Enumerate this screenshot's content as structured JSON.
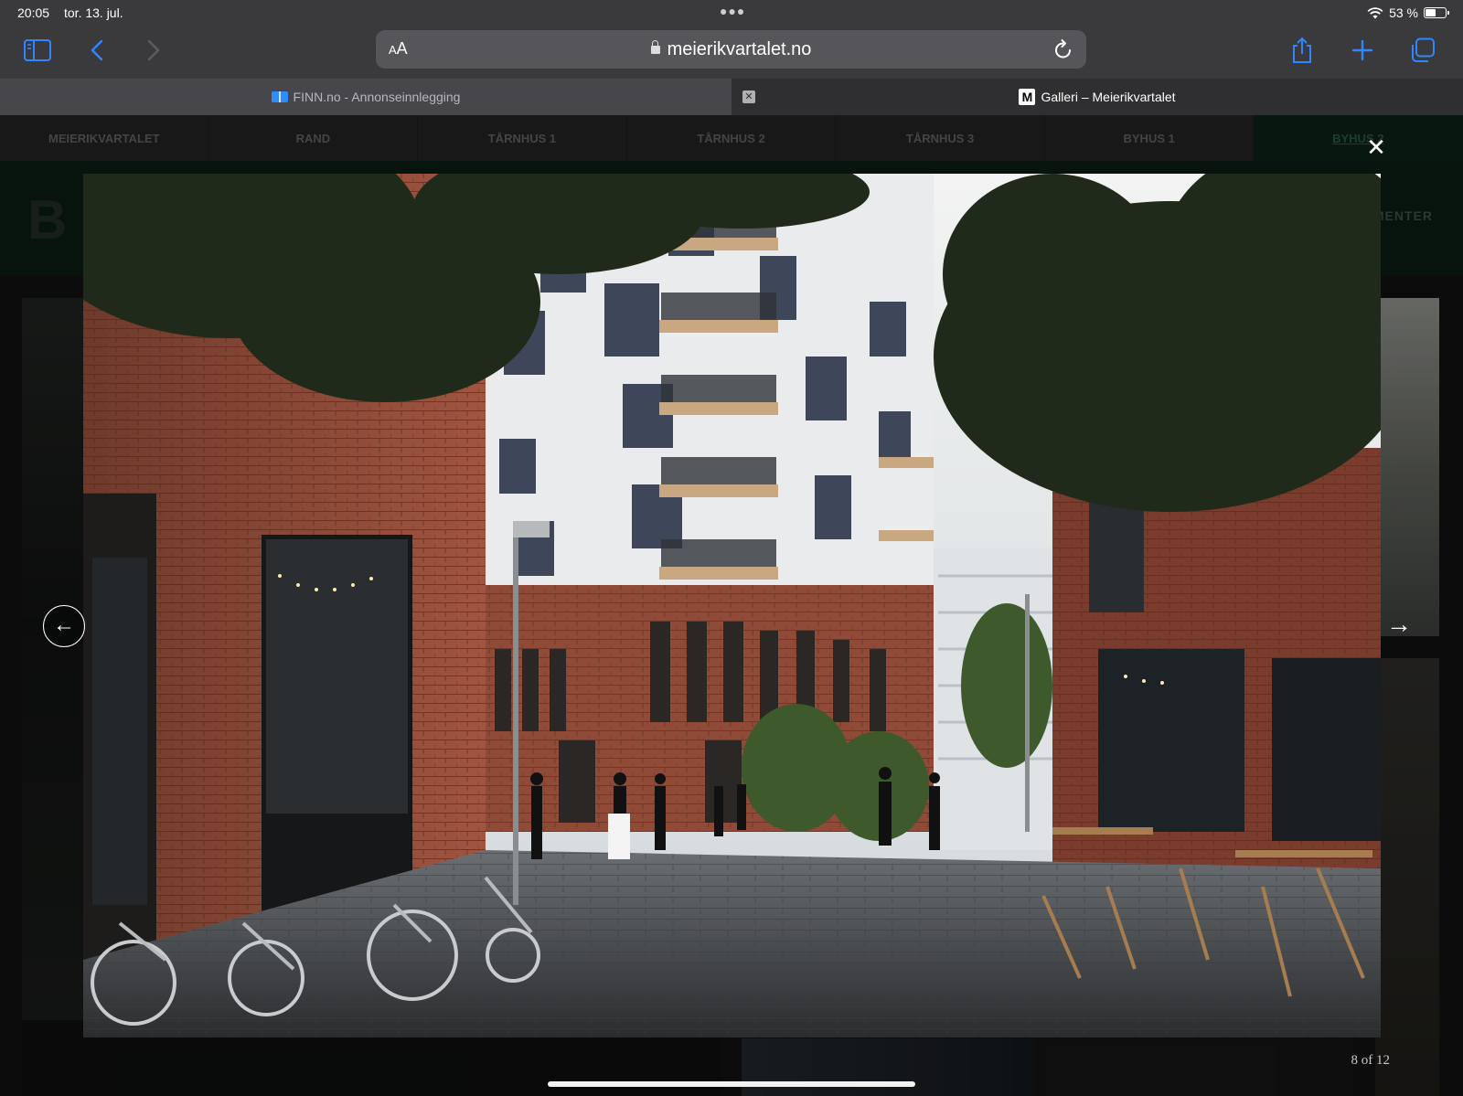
{
  "status_bar": {
    "time": "20:05",
    "date": "tor. 13. jul.",
    "battery": "53 %",
    "battery_level": 0.53
  },
  "toolbar": {
    "url_aa_small": "A",
    "url_aa_large": "A",
    "url": "meierikvartalet.no"
  },
  "tabs": [
    {
      "title": "FINN.no - Annonseinnlegging",
      "active": false,
      "icon": "finn-book-icon"
    },
    {
      "title": "Galleri – Meierikvartalet",
      "active": true,
      "icon": "m-logo-icon"
    }
  ],
  "site": {
    "nav": [
      "MEIERIKVARTALET",
      "RAND",
      "TÅRNHUS 1",
      "TÅRNHUS 2",
      "TÅRNHUS 3",
      "BYHUS 1",
      "BYHUS 2"
    ],
    "nav_active_index": 6,
    "logo_letter": "B",
    "side_label": "MENTER"
  },
  "lightbox": {
    "counter": "8 of 12",
    "close_glyph": "✕",
    "prev_glyph": "←",
    "next_glyph": "→"
  },
  "colors": {
    "toolbar_bg": "#3a3a3c",
    "accent_blue": "#2f86ff",
    "site_header_green": "#0e2318"
  }
}
